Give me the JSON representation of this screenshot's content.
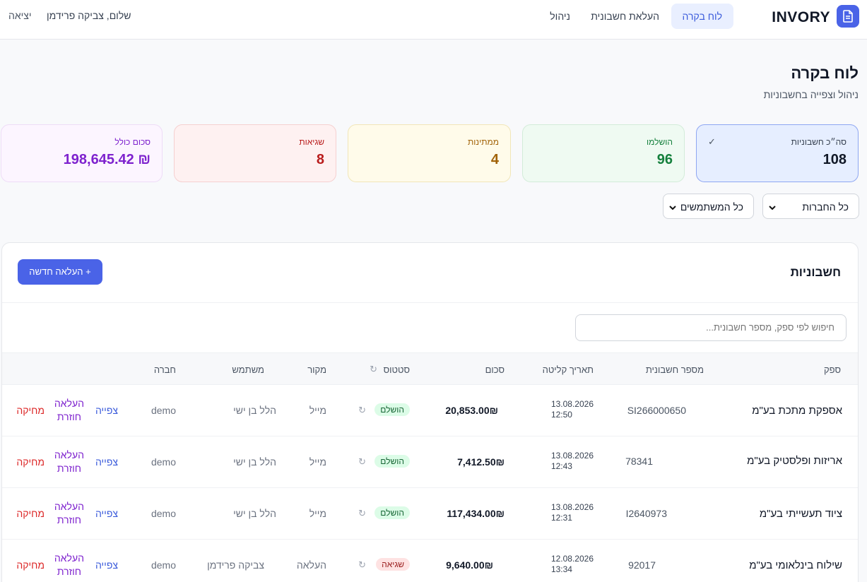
{
  "brand": {
    "name": "INVORY"
  },
  "nav": {
    "dashboard": "לוח בקרה",
    "upload": "העלאת חשבונית",
    "admin": "ניהול",
    "greeting": "שלום, צביקה פרידמן",
    "logout": "יציאה"
  },
  "page": {
    "title": "לוח בקרה",
    "subtitle": "ניהול וצפייה בחשבוניות"
  },
  "stats": {
    "total": {
      "label": "סה״כ חשבוניות",
      "value": "108",
      "check": "✓"
    },
    "completed": {
      "label": "הושלמו",
      "value": "96"
    },
    "pending": {
      "label": "ממתינות",
      "value": "4"
    },
    "errors": {
      "label": "שגיאות",
      "value": "8"
    },
    "sum": {
      "label": "סכום כולל",
      "value": "₪ 198,645.42"
    }
  },
  "filters": {
    "companies": "כל החברות",
    "users": "כל המשתמשים",
    "chevron": "⌄"
  },
  "invoices": {
    "title": "חשבוניות",
    "new_button": "+ העלאה חדשה",
    "search_placeholder": "חיפוש לפי ספק, מספר חשבונית...",
    "headers": {
      "vendor": "ספק",
      "invoice_no": "מספר חשבונית",
      "date": "תאריך קליטה",
      "amount": "סכום",
      "status": "סטטוס",
      "source": "מקור",
      "user": "משתמש",
      "company": "חברה",
      "refresh": "↻"
    },
    "rows": [
      {
        "vendor": "אספקת מתכת בע\"מ",
        "invoice_no": "SI266000650",
        "date": "13.08.2026",
        "time": "12:50",
        "amount": "20,853.00₪",
        "status": "הושלם",
        "refresh": "↻",
        "source": "מייל",
        "user": "הלל בן ישי",
        "company": "demo",
        "view": "צפייה",
        "return1": "העלאה",
        "return2": "חוזרת",
        "delete": "מחיקה"
      },
      {
        "vendor": "אריזות ופלסטיק בע\"מ",
        "invoice_no": "78341",
        "date": "13.08.2026",
        "time": "12:43",
        "amount": "7,412.50₪",
        "status": "הושלם",
        "refresh": "↻",
        "source": "מייל",
        "user": "הלל בן ישי",
        "company": "demo",
        "view": "צפייה",
        "return1": "העלאה",
        "return2": "חוזרת",
        "delete": "מחיקה"
      },
      {
        "vendor": "ציוד תעשייתי בע\"מ",
        "invoice_no": "I2640973",
        "date": "13.08.2026",
        "time": "12:31",
        "amount": "117,434.00₪",
        "status": "הושלם",
        "refresh": "↻",
        "source": "מייל",
        "user": "הלל בן ישי",
        "company": "demo",
        "view": "צפייה",
        "return1": "העלאה",
        "return2": "חוזרת",
        "delete": "מחיקה"
      },
      {
        "vendor": "שילוח בינלאומי בע\"מ",
        "invoice_no": "92017",
        "date": "12.08.2026",
        "time": "13:34",
        "amount": "9,640.00₪",
        "status": "שגיאה",
        "refresh": "↻",
        "source": "העלאה",
        "user": "צביקה פרידמן",
        "company": "demo",
        "view": "צפייה",
        "return1": "העלאה",
        "return2": "חוזרת",
        "delete": "מחיקה"
      }
    ]
  },
  "colors": {
    "accent": "#4a63e7",
    "completed": "#15803d",
    "pending": "#a16207",
    "error": "#b91c1c",
    "sum": "#7e22ce"
  }
}
